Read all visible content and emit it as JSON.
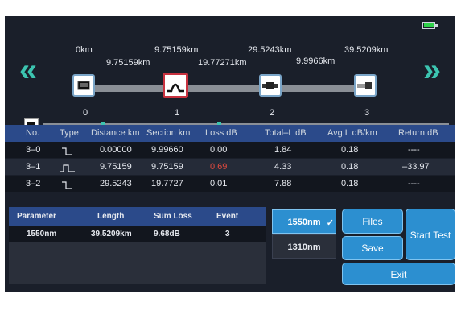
{
  "status": {
    "battery_icon": "battery-icon"
  },
  "trace_map": {
    "distances_top": [
      "0km",
      "9.75159km",
      "29.5243km",
      "39.5209km"
    ],
    "distances_mid": [
      "9.75159km",
      "19.77271km",
      "9.9966km"
    ],
    "event_numbers": [
      "0",
      "1",
      "2",
      "3"
    ],
    "colors": {
      "accent": "#3cc4b0",
      "selected": "#c8323f"
    }
  },
  "event_table": {
    "headers": [
      "No.",
      "Type",
      "Distance km",
      "Section km",
      "Loss dB",
      "Total–L dB",
      "Avg.L dB/km",
      "Return dB"
    ],
    "rows": [
      {
        "no": "3–0",
        "dist": "0.00000",
        "section": "9.99660",
        "loss": "0.00",
        "total": "1.84",
        "avg": "0.18",
        "ret": "----"
      },
      {
        "no": "3–1",
        "dist": "9.75159",
        "section": "9.75159",
        "loss": "0.69",
        "total": "4.33",
        "avg": "0.18",
        "ret": "–33.97"
      },
      {
        "no": "3–2",
        "dist": "29.5243",
        "section": "19.7727",
        "loss": "0.01",
        "total": "7.88",
        "avg": "0.18",
        "ret": "----"
      }
    ]
  },
  "parameter_table": {
    "headers": [
      "Parameter",
      "Length",
      "Sum Loss",
      "Event"
    ],
    "row": {
      "parameter": "1550nm",
      "length": "39.5209km",
      "sum_loss": "9.68dB",
      "event": "3"
    }
  },
  "wavelength": {
    "active": "1550nm",
    "inactive": "1310nm"
  },
  "buttons": {
    "files": "Files",
    "save": "Save",
    "start": "Start Test",
    "exit": "Exit"
  }
}
